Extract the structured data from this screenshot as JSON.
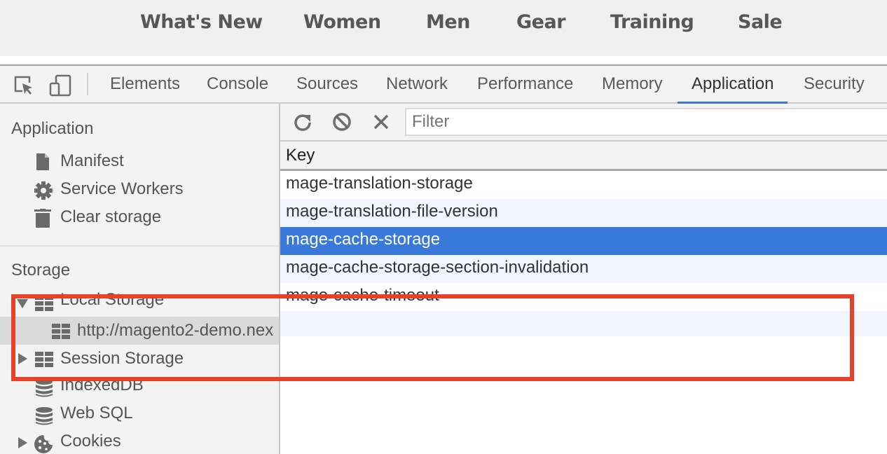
{
  "site_nav": {
    "items": [
      "What's New",
      "Women",
      "Men",
      "Gear",
      "Training",
      "Sale"
    ]
  },
  "devtools": {
    "toolbar": {
      "inspect_icon": "inspect-element-icon",
      "device_icon": "device-toggle-icon",
      "tabs": [
        {
          "label": "Elements",
          "active": false
        },
        {
          "label": "Console",
          "active": false
        },
        {
          "label": "Sources",
          "active": false
        },
        {
          "label": "Network",
          "active": false
        },
        {
          "label": "Performance",
          "active": false
        },
        {
          "label": "Memory",
          "active": false
        },
        {
          "label": "Application",
          "active": true
        },
        {
          "label": "Security",
          "active": false
        }
      ]
    },
    "sidebar": {
      "application_section": {
        "title": "Application",
        "items": [
          {
            "label": "Manifest",
            "icon": "document-icon"
          },
          {
            "label": "Service Workers",
            "icon": "gear-icon"
          },
          {
            "label": "Clear storage",
            "icon": "trash-icon"
          }
        ]
      },
      "storage_section": {
        "title": "Storage",
        "items": [
          {
            "label": "Local Storage",
            "icon": "grid-icon",
            "expanded": true
          },
          {
            "label": "http://magento2-demo.nex",
            "icon": "grid-icon",
            "selected": true
          },
          {
            "label": "Session Storage",
            "icon": "grid-icon",
            "expanded": false
          },
          {
            "label": "IndexedDB",
            "icon": "database-icon"
          },
          {
            "label": "Web SQL",
            "icon": "database-icon"
          },
          {
            "label": "Cookies",
            "icon": "cookie-icon",
            "expanded": false
          }
        ]
      }
    },
    "main": {
      "toolbar": {
        "refresh_icon": "refresh-icon",
        "clear_icon": "block-icon",
        "delete_icon": "close-icon",
        "filter_placeholder": "Filter",
        "filter_value": ""
      },
      "table": {
        "column_header": "Key",
        "rows": [
          "mage-translation-storage",
          "mage-translation-file-version",
          "mage-cache-storage",
          "mage-cache-storage-section-invalidation",
          "mage-cache-timeout"
        ],
        "selected_index": 2
      }
    },
    "annotation_color": "#e8412a",
    "accent_color": "#3879d9"
  }
}
